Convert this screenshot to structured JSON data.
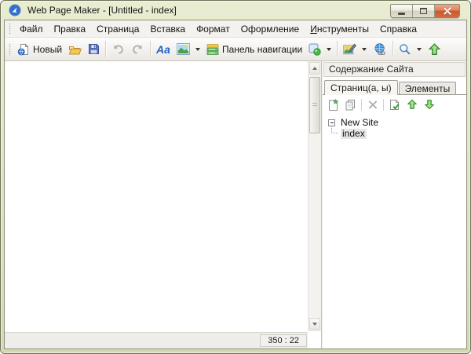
{
  "window": {
    "title": "Web Page Maker - [Untitled - index]"
  },
  "menu": {
    "items": [
      "Файл",
      "Правка",
      "Страница",
      "Вставка",
      "Формат",
      "Оформление",
      "Инструменты",
      "Справка"
    ]
  },
  "toolbar": {
    "new_label": "Новый",
    "nav_panel_label": "Панель навигации",
    "font_glyph": "Aa",
    "icons": [
      "new-page",
      "open-folder",
      "save",
      "undo",
      "redo",
      "font",
      "image",
      "nav-panel",
      "insert-button",
      "style-picker",
      "publish-globe-link",
      "preview-magnifier",
      "publish-up-arrow"
    ]
  },
  "sidebar": {
    "header": "Содержание Сайта",
    "tabs": [
      {
        "label": "Страниц(а, ы)",
        "active": true
      },
      {
        "label": "Элементы",
        "active": false
      }
    ],
    "tools": [
      "add-page",
      "copy-page",
      "delete-page",
      "page-properties",
      "move-up",
      "move-down"
    ],
    "tree": {
      "root": "New Site",
      "child": "index"
    }
  },
  "statusbar": {
    "coords": "350 : 22"
  },
  "colors": {
    "titlebar": "#dbe1b8",
    "close_button": "#cf6038",
    "accent_green": "#4db74d",
    "globe_blue": "#3f8fd6",
    "selection_gray": "#e7e7e7"
  }
}
